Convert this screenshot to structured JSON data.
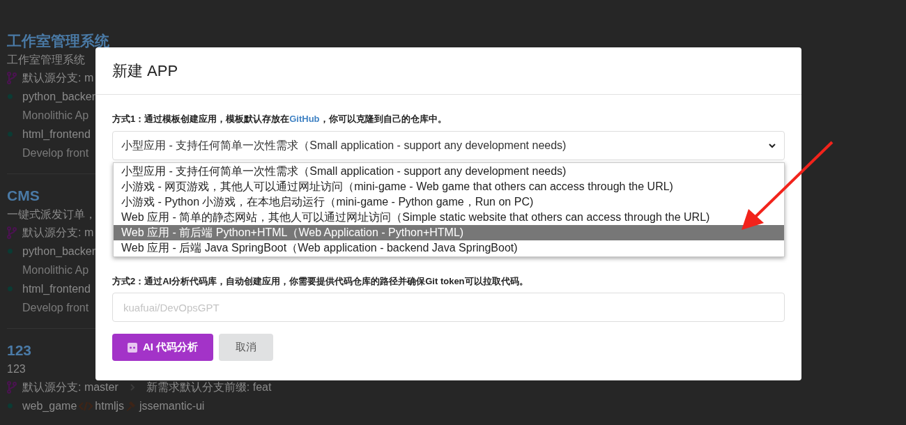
{
  "background": {
    "projects": [
      {
        "title": "工作室管理系统",
        "description": "工作室管理系统",
        "branch": "默认源分支: m",
        "services": [
          {
            "name": "python_backer",
            "detail": "Monolithic Ap"
          },
          {
            "name": "html_frontend",
            "detail": "Develop front"
          }
        ]
      },
      {
        "title": "CMS",
        "description": "一键式派发订单，",
        "branch": "默认源分支: m",
        "services": [
          {
            "name": "python_backer",
            "detail": "Monolithic Ap"
          },
          {
            "name": "html_frontend",
            "detail": "Develop front"
          }
        ]
      },
      {
        "title": "123",
        "description": "123",
        "branch": "默认源分支: master",
        "branch_prefix": "新需求默认分支前缀: feat",
        "services": [
          {
            "name": "web_game",
            "language": "htmljs",
            "framework": "jssemantic-ui"
          }
        ]
      }
    ]
  },
  "modal": {
    "title": "新建 APP",
    "method1": {
      "before": "方式1：通过模板创建应用，模板默认存放在",
      "link": "GitHub",
      "after": "，你可以克隆到自己的仓库中。"
    },
    "select": {
      "value": "小型应用 - 支持任何简单一次性需求（Small application - support any development needs)",
      "expanded": true,
      "options": [
        {
          "label": "小型应用 - 支持任何简单一次性需求（Small application - support any development needs)",
          "highlighted": false
        },
        {
          "label": "小游戏 - 网页游戏，其他人可以通过网址访问（mini-game - Web game that others can access through the URL)",
          "highlighted": false
        },
        {
          "label": "小游戏 - Python 小游戏，在本地启动运行（mini-game - Python game，Run on PC)",
          "highlighted": false
        },
        {
          "label": "Web 应用 - 简单的静态网站，其他人可以通过网址访问（Simple static website that others can access through the URL)",
          "highlighted": false
        },
        {
          "label": "Web 应用 - 前后端 Python+HTML（Web Application - Python+HTML)",
          "highlighted": true
        },
        {
          "label": "Web 应用 - 后端 Java SpringBoot（Web application - backend Java SpringBoot)",
          "highlighted": false
        }
      ]
    },
    "method2": "方式2：通过AI分析代码库，自动创建应用，你需要提供代码仓库的路径并确保Git token可以拉取代码。",
    "repo_input": {
      "placeholder": "kuafuai/DevOpsGPT"
    },
    "buttons": [
      {
        "kind": "primary",
        "label": "AI 代码分析"
      },
      {
        "kind": "secondary",
        "label": "取消"
      }
    ]
  }
}
